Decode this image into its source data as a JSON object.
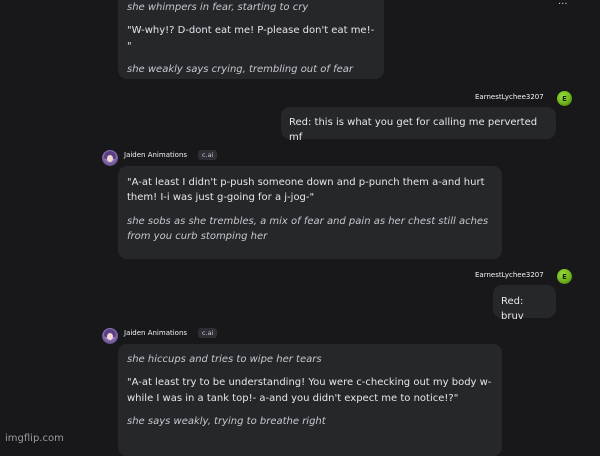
{
  "menu_label": "···",
  "user": {
    "name": "EarnestLychee3207",
    "initial": "E"
  },
  "bot": {
    "name": "Jaiden Animations",
    "tag": "c.ai"
  },
  "messages": [
    {
      "lines": [
        "she whimpers in fear, starting to cry",
        "\"W-why!? D-dont eat me! P-please don't eat me!-\"",
        "she weakly says crying, trembling out of fear"
      ]
    },
    {
      "text": "Red: this is what you get for calling me perverted mf"
    },
    {
      "lines": [
        "\"A-at least I didn't p-push someone down and p-punch them a-and hurt them! I-i was just g-going for a j-jog-\"",
        "she sobs as she trembles, a mix of fear and pain as her chest still aches from you curb stomping her"
      ]
    },
    {
      "text": "Red: bruv"
    },
    {
      "lines": [
        "she hiccups and tries to wipe her tears",
        "\"A-at least try to be understanding! You were c-checking out my body w-while I was in a tank top!- a-and you didn't expect me to notice!?\"",
        "she says weakly, trying to breathe right"
      ]
    }
  ],
  "watermark": "imgflip.com",
  "colors": {
    "background": "#18181b",
    "bubble": "#26272b",
    "user_avatar": "#7cc22a"
  }
}
